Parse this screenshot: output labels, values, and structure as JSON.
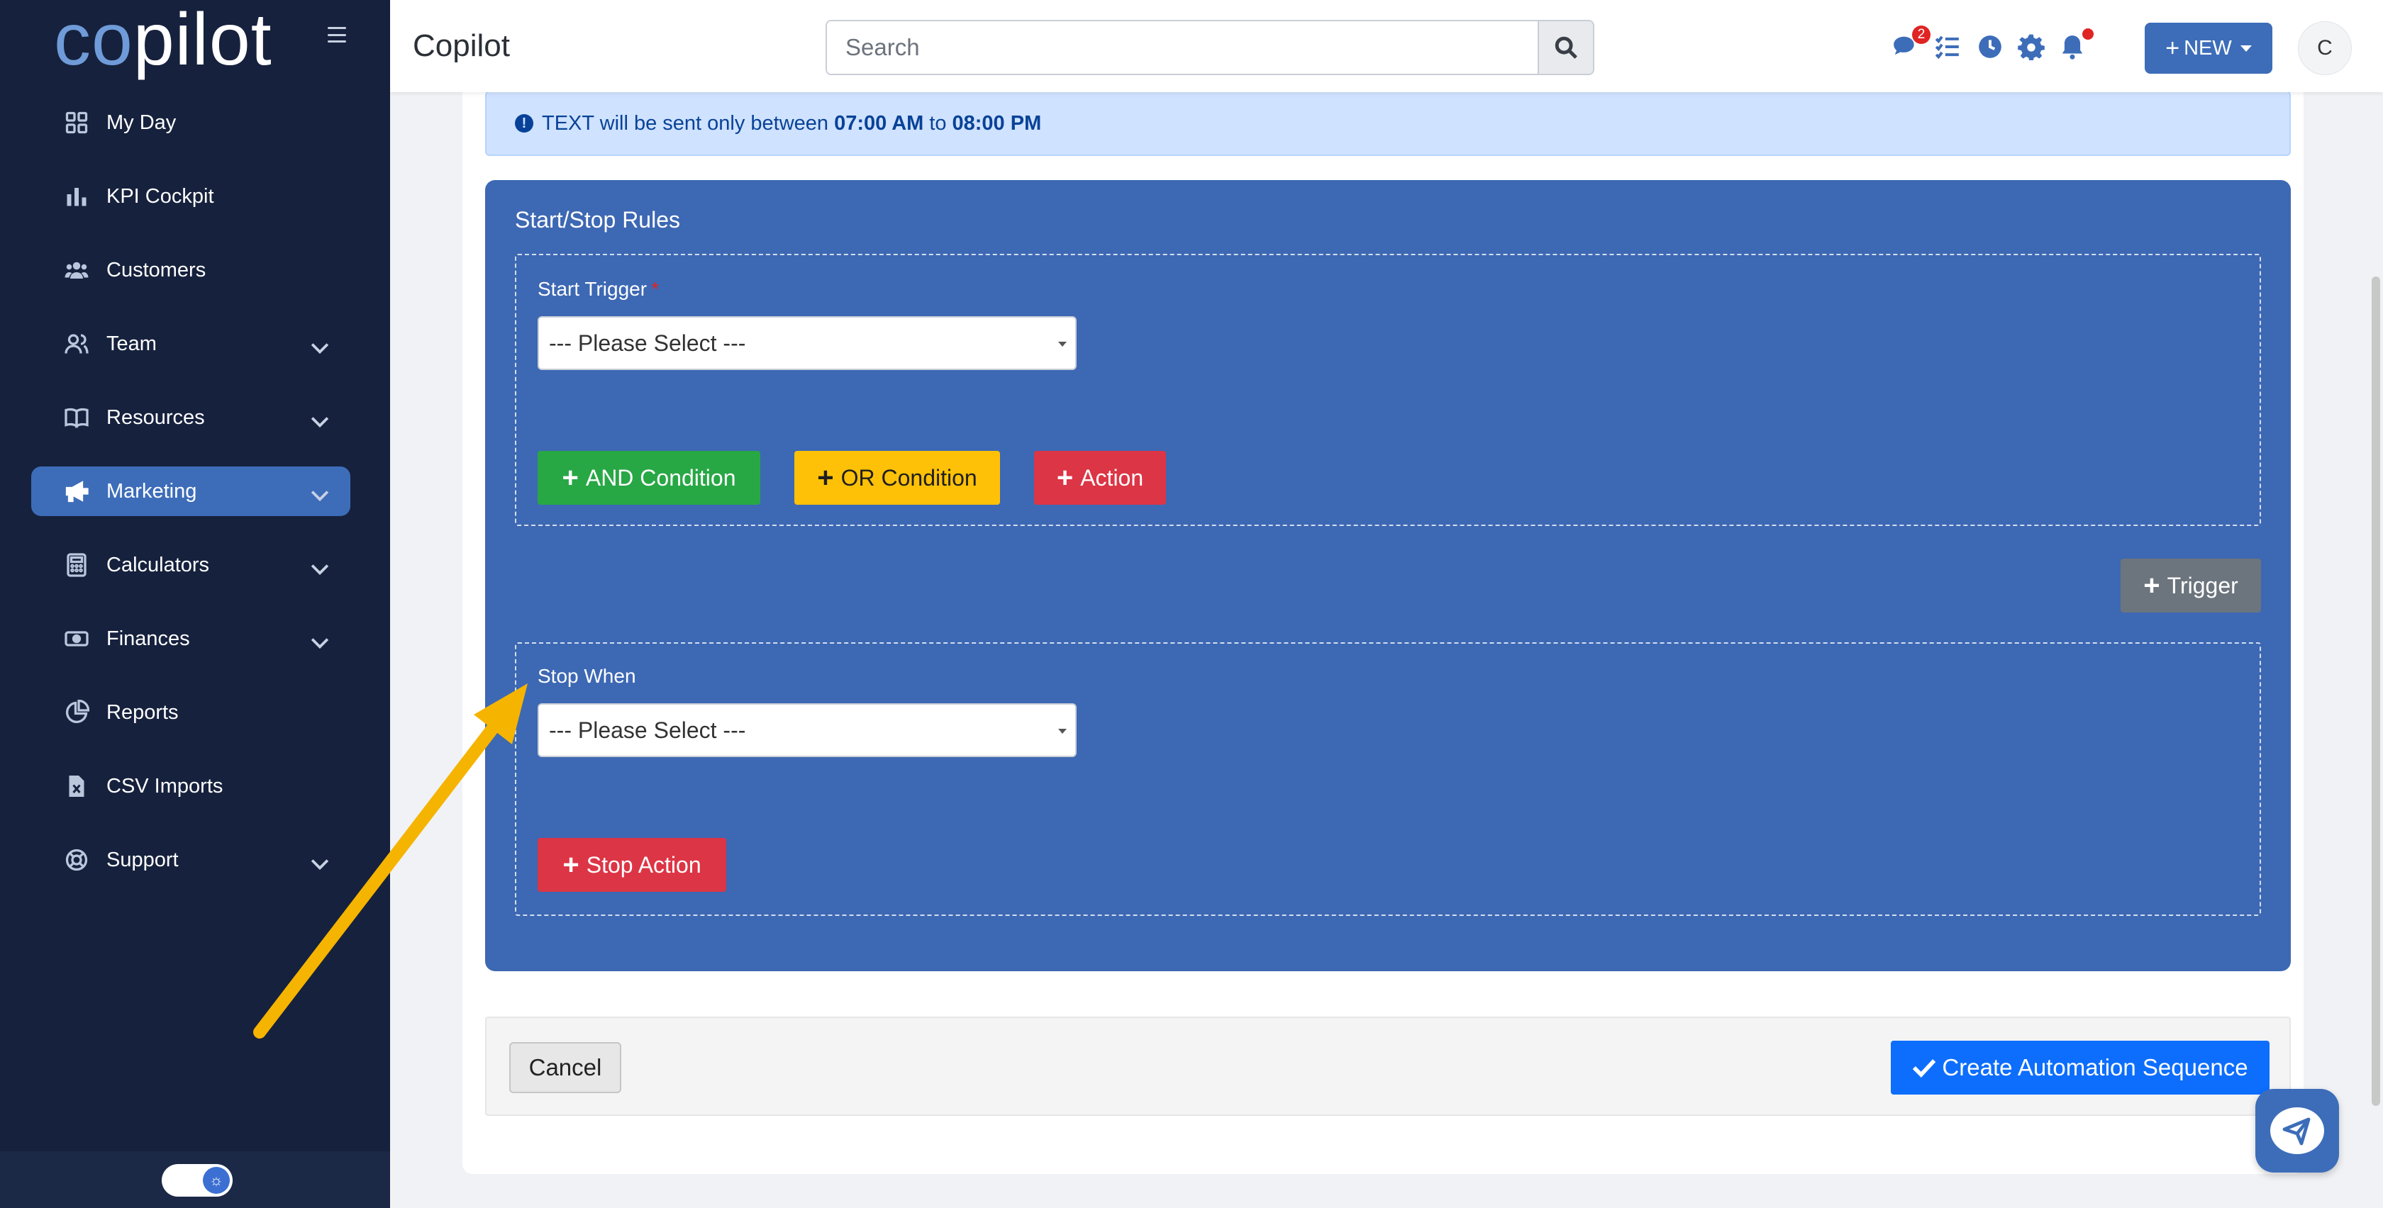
{
  "app": {
    "logo_co": "co",
    "logo_rest": "pilot",
    "page_title": "Copilot"
  },
  "search": {
    "placeholder": "Search"
  },
  "topbar": {
    "chat_badge": "2",
    "new_label": "NEW",
    "avatar_initial": "C"
  },
  "sidebar": {
    "items": [
      {
        "label": "My Day",
        "icon": "grid-icon"
      },
      {
        "label": "KPI Cockpit",
        "icon": "bar-chart-icon"
      },
      {
        "label": "Customers",
        "icon": "users-icon"
      },
      {
        "label": "Team",
        "icon": "team-icon"
      },
      {
        "label": "Resources",
        "icon": "book-icon"
      },
      {
        "label": "Marketing",
        "icon": "megaphone-icon"
      },
      {
        "label": "Calculators",
        "icon": "calculator-icon"
      },
      {
        "label": "Finances",
        "icon": "money-icon"
      },
      {
        "label": "Reports",
        "icon": "pie-chart-icon"
      },
      {
        "label": "CSV Imports",
        "icon": "file-excel-icon"
      },
      {
        "label": "Support",
        "icon": "lifebuoy-icon"
      }
    ]
  },
  "banner": {
    "prefix": "TEXT will be sent only between",
    "start_time": "07:00 AM",
    "mid": "to",
    "end_time": "08:00 PM"
  },
  "rules": {
    "title": "Start/Stop Rules",
    "start_trigger_label": "Start Trigger",
    "required_mark": "*",
    "start_select_value": "--- Please Select ---",
    "and_condition": "AND Condition",
    "or_condition": "OR Condition",
    "action": "Action",
    "trigger": "Trigger",
    "stop_when_label": "Stop When",
    "stop_select_value": "--- Please Select ---",
    "stop_action": "Stop Action"
  },
  "footer": {
    "cancel": "Cancel",
    "create": "Create Automation Sequence"
  },
  "colors": {
    "sidebar_bg": "#16213d",
    "accent": "#3d6db9",
    "panel_blue": "#3d68b3",
    "green": "#28a745",
    "yellow": "#ffc107",
    "red": "#dc3545",
    "annotation_arrow": "#f5b400"
  }
}
